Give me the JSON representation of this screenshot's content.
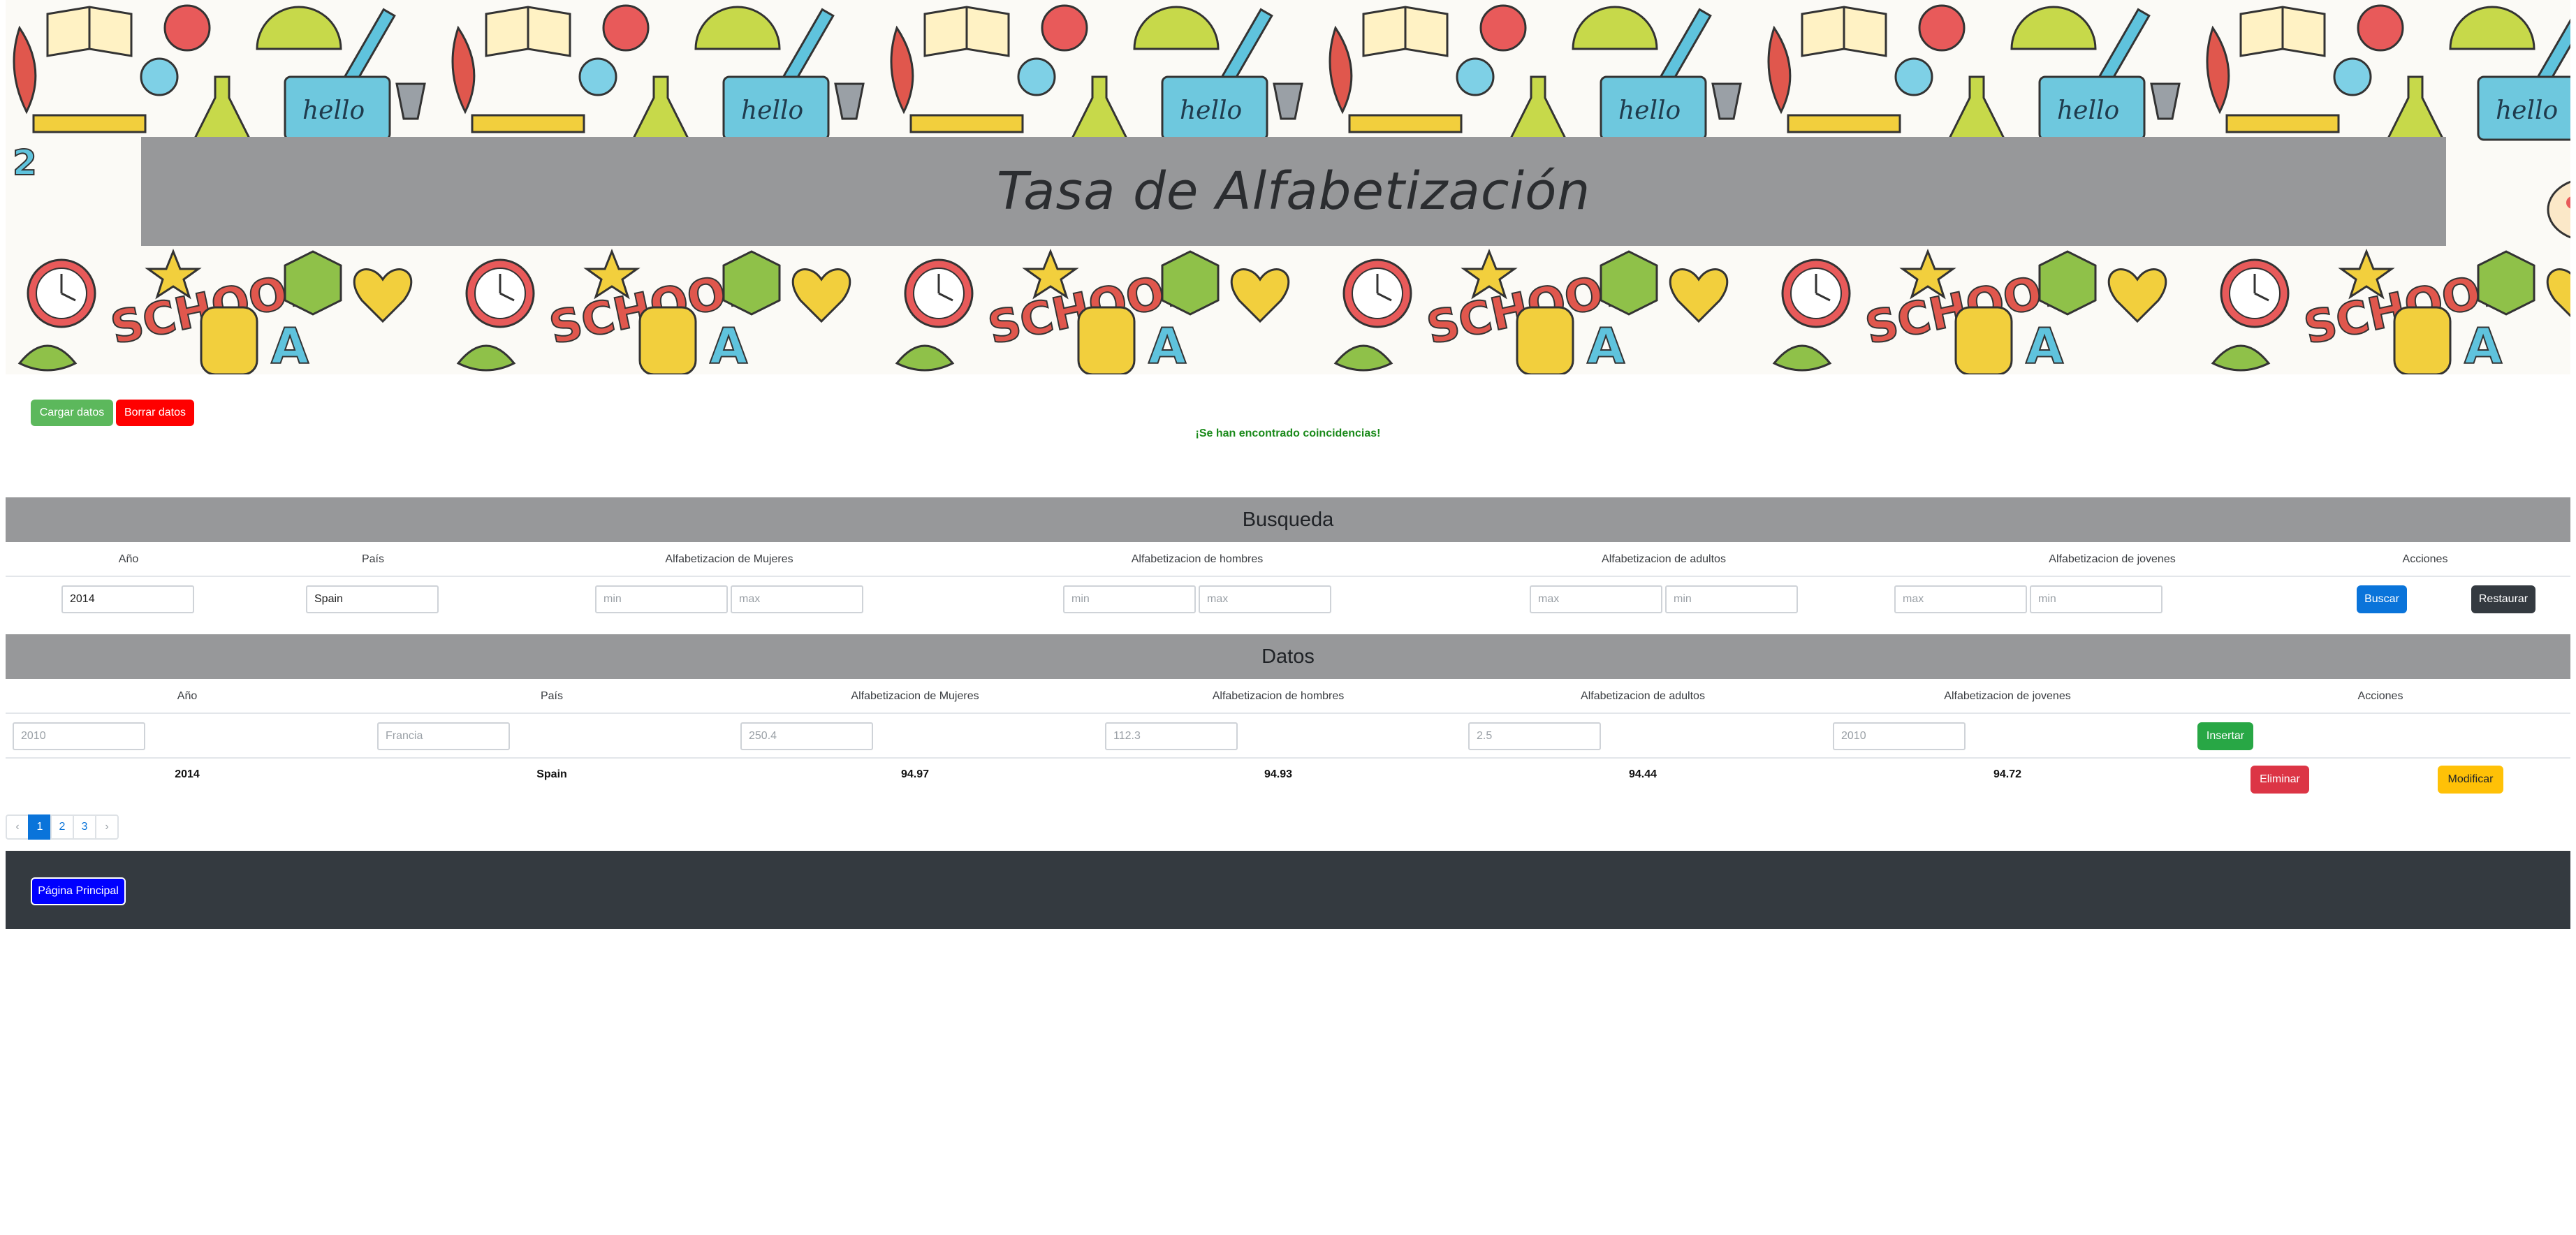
{
  "header": {
    "title": "Tasa de Alfabetización"
  },
  "actions": {
    "load_label": "Cargar datos",
    "delete_label": "Borrar datos"
  },
  "status_message": "¡Se han encontrado coincidencias!",
  "search": {
    "heading": "Busqueda",
    "columns": [
      "Año",
      "País",
      "Alfabetizacion de Mujeres",
      "Alfabetizacion de hombres",
      "Alfabetizacion de adultos",
      "Alfabetizacion de jovenes",
      "Acciones"
    ],
    "year_value": "2014",
    "country_value": "Spain",
    "women_min_placeholder": "min",
    "women_max_placeholder": "max",
    "men_min_placeholder": "min",
    "men_max_placeholder": "max",
    "adults_first_placeholder": "max",
    "adults_second_placeholder": "min",
    "young_first_placeholder": "max",
    "young_second_placeholder": "min",
    "search_label": "Buscar",
    "reset_label": "Restaurar"
  },
  "data": {
    "heading": "Datos",
    "columns": [
      "Año",
      "País",
      "Alfabetizacion de Mujeres",
      "Alfabetizacion de hombres",
      "Alfabetizacion de adultos",
      "Alfabetizacion de jovenes",
      "Acciones"
    ],
    "new_row_placeholders": [
      "2010",
      "Francia",
      "250.4",
      "112.3",
      "2.5",
      "2010"
    ],
    "insert_label": "Insertar",
    "rows": [
      {
        "year": "2014",
        "country": "Spain",
        "women": "94.97",
        "men": "94.93",
        "adults": "94.44",
        "young": "94.72"
      }
    ],
    "delete_label": "Eliminar",
    "modify_label": "Modificar"
  },
  "pagination": {
    "prev": "‹",
    "pages": [
      "1",
      "2",
      "3"
    ],
    "next": "›",
    "active": "1"
  },
  "footer": {
    "home_label": "Página Principal"
  },
  "colors": {
    "banner_title_bg": "#97989a",
    "footer_bg": "#343a40",
    "primary": "#0a74da"
  }
}
